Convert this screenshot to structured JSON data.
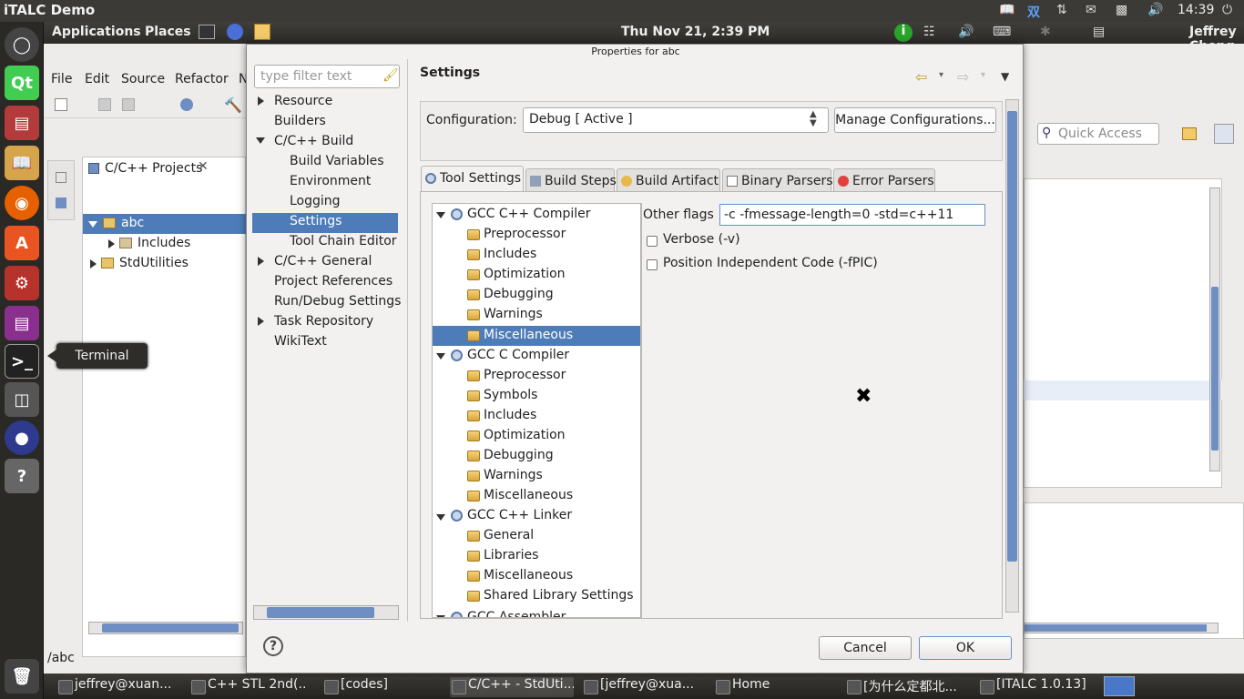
{
  "italc": {
    "title": "iTALC Demo",
    "clock": "14:39"
  },
  "panel": {
    "applications": "Applications",
    "places": "Places",
    "datetime": "Thu Nov 21,  2:39 PM",
    "user": "Jeffrey Cheng"
  },
  "launcher": {
    "tooltip": "Terminal",
    "qt_label": "Qt"
  },
  "eclipse": {
    "menu": [
      "File",
      "Edit",
      "Source",
      "Refactor",
      "N"
    ],
    "project_tab": "C/C++ Projects",
    "tree": [
      "abc",
      "Includes",
      "StdUtilities"
    ],
    "status": "/abc",
    "quick_access": "Quick Access"
  },
  "taskbar": [
    "jeffrey@xuan...",
    "C++ STL 2nd(...",
    "[codes]",
    "C/C++ - StdUti...",
    "[jeffrey@xua...",
    "Home",
    "[为什么定都北...",
    "[ITALC 1.0.13]"
  ],
  "dialog": {
    "title": "Properties for abc",
    "filter_placeholder": "type filter text",
    "nav": {
      "resource": "Resource",
      "builders": "Builders",
      "cpp_build": "C/C++ Build",
      "build_variables": "Build Variables",
      "environment": "Environment",
      "logging": "Logging",
      "settings": "Settings",
      "tool_chain_editor": "Tool Chain Editor",
      "cpp_general": "C/C++ General",
      "project_references": "Project References",
      "run_debug": "Run/Debug Settings",
      "task_repository": "Task Repository",
      "wikitext": "WikiText"
    },
    "page_title": "Settings",
    "configuration_label": "Configuration:",
    "configuration_value": "Debug  [ Active ]",
    "manage_button": "Manage Configurations...",
    "tabs": [
      "Tool Settings",
      "Build Steps",
      "Build Artifact",
      "Binary Parsers",
      "Error Parsers"
    ],
    "tool_tree": {
      "gpp_compiler": "GCC C++ Compiler",
      "gpp_children": [
        "Preprocessor",
        "Includes",
        "Optimization",
        "Debugging",
        "Warnings",
        "Miscellaneous"
      ],
      "gcc_compiler": "GCC C Compiler",
      "gcc_children": [
        "Preprocessor",
        "Symbols",
        "Includes",
        "Optimization",
        "Debugging",
        "Warnings",
        "Miscellaneous"
      ],
      "gpp_linker": "GCC C++ Linker",
      "linker_children": [
        "General",
        "Libraries",
        "Miscellaneous",
        "Shared Library Settings"
      ],
      "gcc_assembler": "GCC Assembler"
    },
    "other_flags_label": "Other flags",
    "other_flags_value": "-c -fmessage-length=0 -std=c++11",
    "verbose_label": "Verbose (-v)",
    "fpic_label": "Position Independent Code (-fPIC)",
    "help_glyph": "?",
    "cancel": "Cancel",
    "ok": "OK"
  },
  "colors": {
    "selection": "#4e7cb8",
    "panel": "#3b3a36",
    "dialog_bg": "#f2f1f0"
  }
}
